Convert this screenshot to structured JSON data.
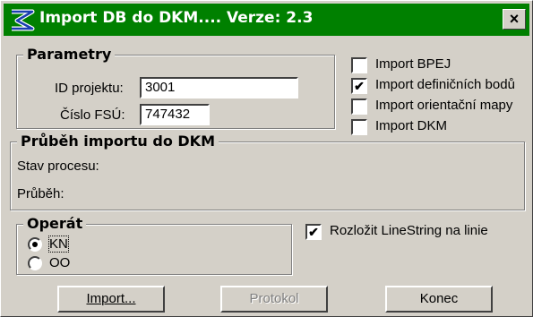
{
  "window": {
    "title": "Import DB do DKM.... Verze: 2.3",
    "close_label": "×",
    "title_bg": "#008000"
  },
  "parametry": {
    "legend": "Parametry",
    "id_label": "ID projektu:",
    "id_value": "3001",
    "fsu_label": "Číslo FSÚ:",
    "fsu_value": "747432"
  },
  "imports": [
    {
      "label": "Import BPEJ",
      "checked": false,
      "mark": ""
    },
    {
      "label": "Import definičních bodů",
      "checked": true,
      "mark": "✔"
    },
    {
      "label": "Import orientační mapy",
      "checked": false,
      "mark": ""
    },
    {
      "label": "Import DKM",
      "checked": false,
      "mark": ""
    }
  ],
  "progress": {
    "legend": "Průběh importu do DKM",
    "status_label": "Stav procesu:",
    "progress_label": "Průběh:"
  },
  "operat": {
    "legend": "Operát",
    "options": [
      {
        "label": "KN",
        "selected": true
      },
      {
        "label": "OO",
        "selected": false
      }
    ]
  },
  "linestring": {
    "label": "Rozložit LineString na linie",
    "checked": true,
    "mark": "✔"
  },
  "buttons": {
    "import": "Import...",
    "protokol": "Protokol",
    "konec": "Konec"
  }
}
